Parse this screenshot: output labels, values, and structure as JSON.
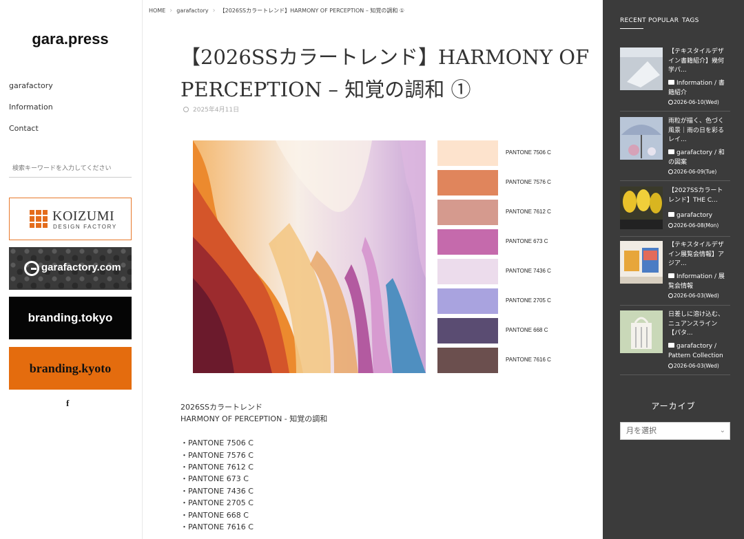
{
  "left": {
    "logo": "gara.press",
    "nav": [
      "garafactory",
      "Information",
      "Contact"
    ],
    "search_placeholder": "検索キーワードを入力してください",
    "banners": {
      "koizumi_main": "KOIZUMI",
      "koizumi_sub": "DESIGN FACTORY",
      "garafactory": "garafactory.com",
      "tokyo": "branding.tokyo",
      "kyoto": "branding.kyoto"
    },
    "facebook": "f"
  },
  "main": {
    "breadcrumb": [
      "HOME",
      "garafactory",
      "【2026SSカラートレンド】HARMONY OF PERCEPTION – 知覚の調和 ①"
    ],
    "title": "【2026SSカラートレンド】HARMONY OF PERCEPTION – 知覚の調和 ①",
    "date": "2025年4月11日",
    "swatches": [
      {
        "label": "PANTONE 7506 C",
        "color": "#fde3cd"
      },
      {
        "label": "PANTONE 7576 C",
        "color": "#e0855c"
      },
      {
        "label": "PANTONE 7612 C",
        "color": "#d59a8e"
      },
      {
        "label": "PANTONE 673 C",
        "color": "#c56aac"
      },
      {
        "label": "PANTONE 7436 C",
        "color": "#ecdcec"
      },
      {
        "label": "PANTONE 2705 C",
        "color": "#a9a3df"
      },
      {
        "label": "PANTONE 668 C",
        "color": "#5a4c72"
      },
      {
        "label": "PANTONE 7616 C",
        "color": "#6b4f4e"
      }
    ],
    "body_lines": [
      "2026SSカラートレンド",
      "HARMONY OF PERCEPTION - 知覚の調和",
      "",
      "・PANTONE 7506 C",
      "・PANTONE 7576 C",
      "・PANTONE 7612 C",
      "・PANTONE 673 C",
      "・PANTONE 7436 C",
      "・PANTONE 2705 C",
      "・PANTONE 668 C",
      "・PANTONE 7616 C"
    ]
  },
  "right": {
    "tabs": [
      "RECENT",
      "POPULAR",
      "TAGS"
    ],
    "posts": [
      {
        "title": "【テキスタイルデザイン書籍紹介】幾何学パ...",
        "category": "Information / 書籍紹介",
        "date": "2026-06-10(Wed)"
      },
      {
        "title": "雨粒が描く、色づく風景｜雨の日を彩るレイ...",
        "category": "garafactory / 和の図案",
        "date": "2026-06-09(Tue)"
      },
      {
        "title": "【2027SSカラートレンド】THE C...",
        "category": "garafactory",
        "date": "2026-06-08(Mon)"
      },
      {
        "title": "【テキスタイルデザイン展覧会情報】アジア...",
        "category": "Information / 展覧会情報",
        "date": "2026-06-03(Wed)"
      },
      {
        "title": "日差しに溶け込む、ニュアンスライン【パタ...",
        "category": "garafactory / Pattern Collection",
        "date": "2026-06-03(Wed)"
      }
    ],
    "archive_title": "アーカイブ",
    "archive_select": "月を選択"
  }
}
